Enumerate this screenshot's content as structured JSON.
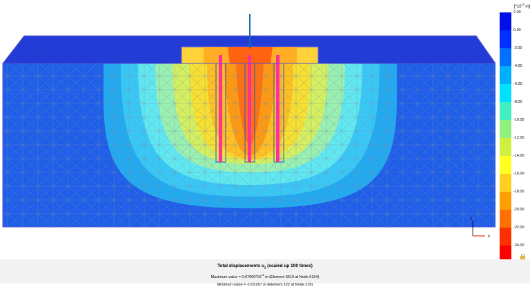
{
  "legend": {
    "unit_prefix": "[*10",
    "unit_exp": "-3",
    "unit_suffix": " m]",
    "ticks": [
      "2.00",
      "0.00",
      "-2.00",
      "-4.00",
      "-6.00",
      "-8.00",
      "-10.00",
      "-12.00",
      "-14.00",
      "-16.00",
      "-18.00",
      "-20.00",
      "-22.00",
      "-24.00"
    ],
    "colors": [
      "#0010e6",
      "#0030ff",
      "#0070ff",
      "#00b0ff",
      "#00e0ff",
      "#40f0c0",
      "#90f080",
      "#d0f040",
      "#ffff20",
      "#ffd020",
      "#ffa000",
      "#ff7000",
      "#ff3000",
      "#ff0000"
    ]
  },
  "axes": {
    "z": "z",
    "x": "x"
  },
  "footer": {
    "title_prefix": "Total displacements u",
    "title_sub": "z",
    "title_suffix": " (scaled up 100 times)",
    "max_prefix": "Maximum value = 0.07666*10",
    "max_exp": "-3",
    "max_suffix": " m (Element 3619 at Node 5154)",
    "min_text": "Minimum value = -0.02267 m (Element 122 at Node 218)"
  }
}
